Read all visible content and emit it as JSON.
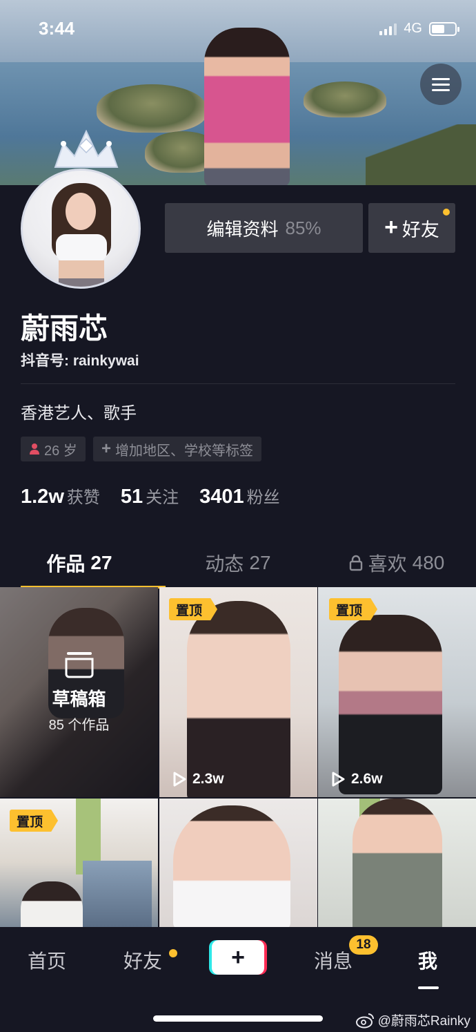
{
  "status_bar": {
    "time": "3:44",
    "network": "4G",
    "battery_percent": 55
  },
  "profile": {
    "name": "蔚雨芯",
    "douyin_id": "抖音号: rainkywai",
    "bio": "香港艺人、歌手",
    "tags": [
      {
        "icon": "person-icon",
        "label": "26 岁"
      },
      {
        "icon": "plus-icon",
        "label": "增加地区、学校等标签"
      }
    ],
    "stats": [
      {
        "value": "1.2w",
        "label": "获赞"
      },
      {
        "value": "51",
        "label": "关注"
      },
      {
        "value": "3401",
        "label": "粉丝"
      }
    ]
  },
  "actions": {
    "edit_label": "编辑资料",
    "edit_progress": "85%",
    "add_friend_label": "好友"
  },
  "tabs": [
    {
      "label": "作品",
      "count": "27",
      "active": true
    },
    {
      "label": "动态",
      "count": "27",
      "active": false
    },
    {
      "label": "喜欢",
      "count": "480",
      "active": false,
      "locked": true
    }
  ],
  "grid": {
    "drafts": {
      "title": "草稿箱",
      "count": "85 个作品"
    },
    "pin_label": "置顶",
    "play_counts": [
      "2.3w",
      "2.6w"
    ]
  },
  "bottom_nav": {
    "items": [
      "首页",
      "好友",
      "消息",
      "我"
    ],
    "message_badge": "18"
  },
  "watermark": "@蔚雨芯Rainky",
  "colors": {
    "accent": "#fdc02f",
    "background": "#161723",
    "button": "#393a44"
  }
}
